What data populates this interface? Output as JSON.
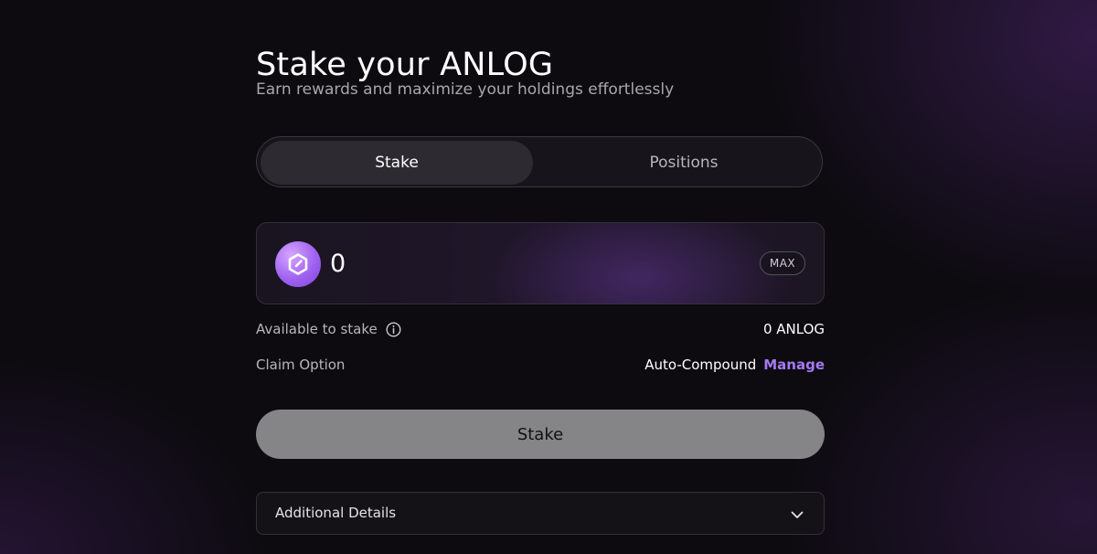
{
  "header": {
    "title": "Stake your ANLOG",
    "subtitle": "Earn rewards and maximize your holdings effortlessly"
  },
  "tabs": [
    {
      "label": "Stake",
      "active": true
    },
    {
      "label": "Positions",
      "active": false
    }
  ],
  "stake_input": {
    "token_icon": "anlog-token-icon",
    "value": "0",
    "max_label": "MAX"
  },
  "available": {
    "label": "Available to stake",
    "icon": "info-icon",
    "value": "0 ANLOG"
  },
  "claim": {
    "label": "Claim Option",
    "value": "Auto-Compound",
    "manage_label": "Manage"
  },
  "stake_button": {
    "label": "Stake"
  },
  "details": {
    "label": "Additional Details",
    "icon": "chevron-down-icon"
  },
  "colors": {
    "accent": "#a679f5",
    "background": "#0d0b10",
    "button_disabled": "#858487"
  }
}
